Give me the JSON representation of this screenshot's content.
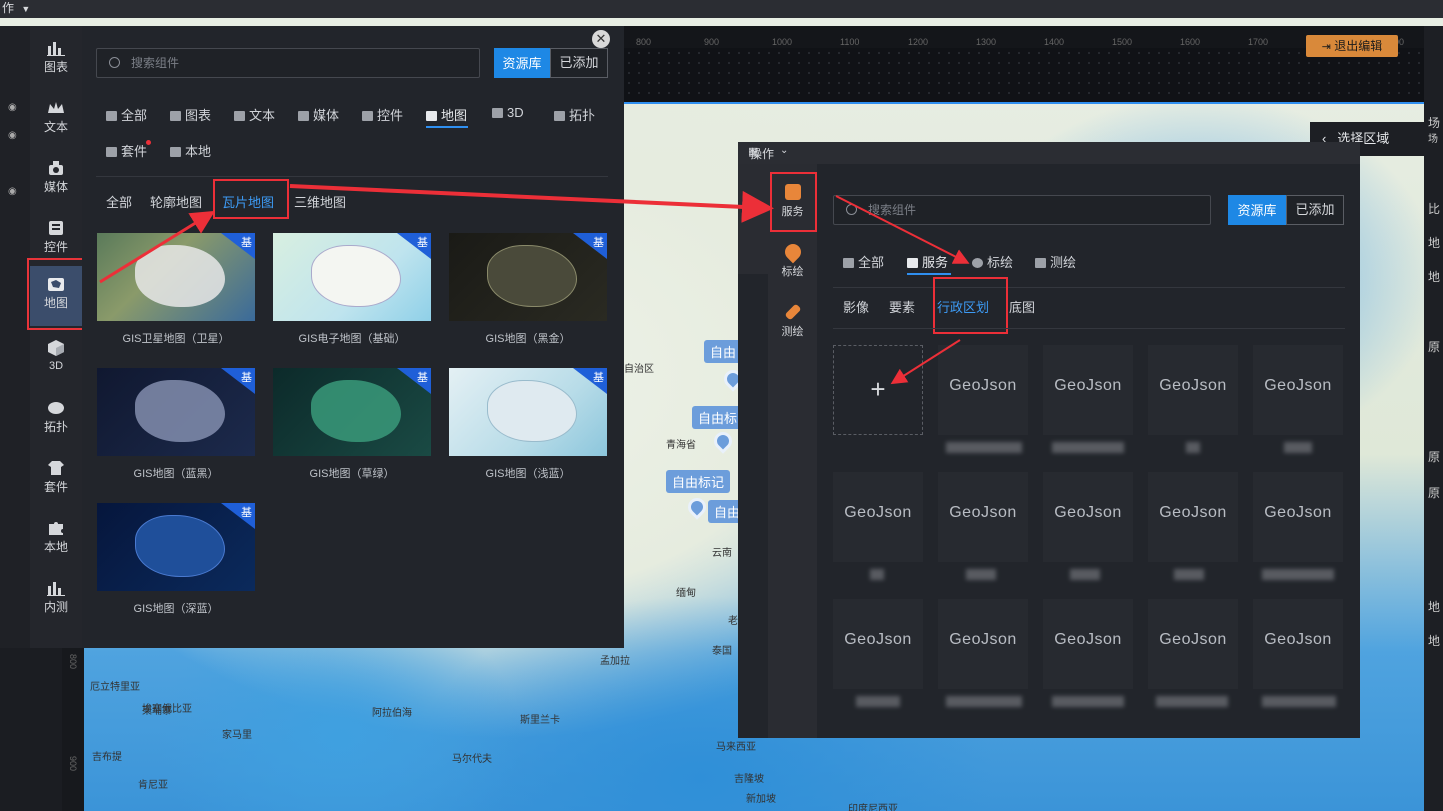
{
  "topbar": {
    "menu_label": "作"
  },
  "editor": {
    "exit_label": "退出编辑",
    "ruler_ticks": [
      "800",
      "900",
      "1000",
      "1100",
      "1200",
      "1300",
      "1400",
      "1500",
      "1600",
      "1700",
      "1800",
      "1900"
    ],
    "vruler_ticks": [
      "800",
      "900"
    ],
    "select_area_label": "选择区域",
    "right_labels": [
      "场",
      "场",
      "比",
      "地",
      "地",
      "原",
      "原",
      "原",
      "地",
      "地"
    ]
  },
  "sidebar": {
    "items": [
      {
        "label": "图表"
      },
      {
        "label": "文本"
      },
      {
        "label": "媒体"
      },
      {
        "label": "控件"
      },
      {
        "label": "地图"
      },
      {
        "label": "3D"
      },
      {
        "label": "拓扑"
      },
      {
        "label": "套件"
      },
      {
        "label": "本地"
      },
      {
        "label": "内测"
      }
    ]
  },
  "library": {
    "search_placeholder": "搜索组件",
    "btn_library": "资源库",
    "btn_added": "已添加",
    "tabs": [
      "全部",
      "图表",
      "文本",
      "媒体",
      "控件",
      "地图",
      "3D",
      "拓扑",
      "套件",
      "本地"
    ],
    "subtabs": [
      "全部",
      "轮廓地图",
      "瓦片地图",
      "三维地图"
    ],
    "badge": "基",
    "cards": [
      {
        "caption": "GIS卫星地图（卫星）"
      },
      {
        "caption": "GIS电子地图（基础）"
      },
      {
        "caption": "GIS地图（黑金）"
      },
      {
        "caption": "GIS地图（蓝黑）"
      },
      {
        "caption": "GIS地图（草绿）"
      },
      {
        "caption": "GIS地图（浅蓝）"
      },
      {
        "caption": "GIS地图（深蓝）"
      }
    ]
  },
  "service": {
    "menu_label": "操作",
    "side": [
      {
        "label": "服务"
      },
      {
        "label": "标绘"
      },
      {
        "label": "测绘"
      }
    ],
    "search_placeholder": "搜索组件",
    "btn_library": "资源库",
    "btn_added": "已添加",
    "tabs": [
      "全部",
      "服务",
      "标绘",
      "测绘"
    ],
    "subtabs": [
      "影像",
      "要素",
      "行政区划",
      "底图"
    ],
    "add_symbol": "+",
    "geojson_label": "GeoJson"
  },
  "map": {
    "tags": [
      "自由",
      "自由标",
      "自由标记",
      "自由"
    ],
    "labels": [
      "青海省",
      "云南",
      "自治区",
      "缅甸",
      "泰国",
      "马来西亚",
      "马尔代夫",
      "斯里兰卡",
      "孟加拉",
      "印度尼西亚",
      "吉隆坡",
      "新加坡",
      "柬埔寨",
      "家马里",
      "肯尼亚",
      "埃塞俄比亚",
      "吉布提",
      "厄立特里亚",
      "阿拉伯海",
      "老"
    ]
  }
}
